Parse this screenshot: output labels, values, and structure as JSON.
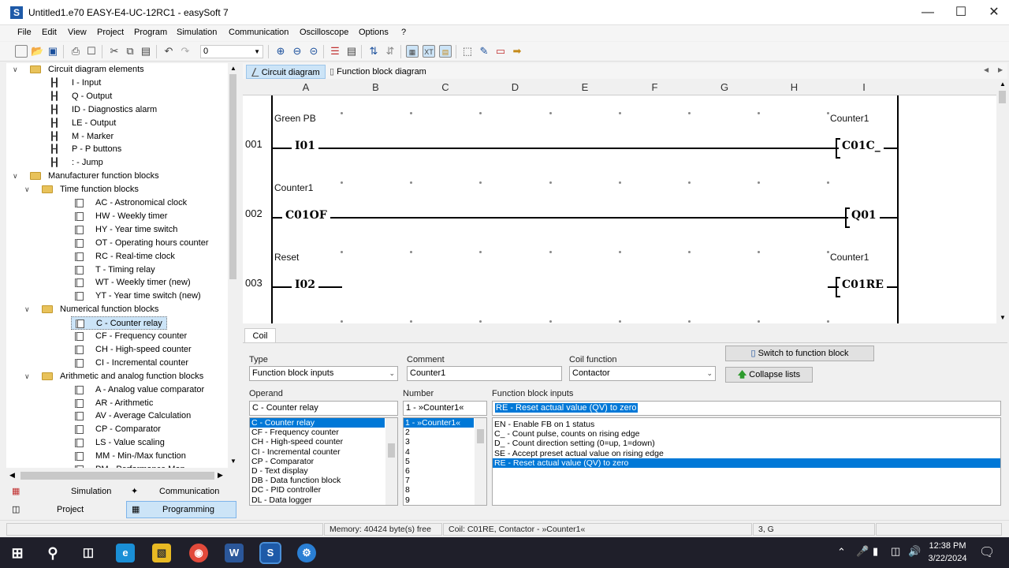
{
  "window": {
    "title": "Untitled1.e70 EASY-E4-UC-12RC1 - easySoft 7",
    "app_icon_letter": "S"
  },
  "menu": [
    "File",
    "Edit",
    "View",
    "Project",
    "Program",
    "Simulation",
    "Communication",
    "Oscilloscope",
    "Options",
    "?"
  ],
  "toolbar": {
    "zoom_value": "0"
  },
  "tree": [
    {
      "level": 0,
      "expanded": true,
      "icon": "folder",
      "label": "Circuit diagram elements"
    },
    {
      "level": 1,
      "icon": "contact",
      "label": "I - Input"
    },
    {
      "level": 1,
      "icon": "contact",
      "label": "Q - Output"
    },
    {
      "level": 1,
      "icon": "contact",
      "label": "ID - Diagnostics alarm"
    },
    {
      "level": 1,
      "icon": "contact",
      "label": "LE - Output"
    },
    {
      "level": 1,
      "icon": "contact",
      "label": "M - Marker"
    },
    {
      "level": 1,
      "icon": "contact",
      "label": "P - P buttons"
    },
    {
      "level": 1,
      "icon": "contact",
      "label": ": - Jump"
    },
    {
      "level": 0,
      "expanded": true,
      "icon": "folder",
      "label": "Manufacturer function blocks"
    },
    {
      "level": 1,
      "expanded": true,
      "icon": "folder",
      "label": "Time function blocks"
    },
    {
      "level": 2,
      "icon": "fb",
      "label": "AC - Astronomical clock"
    },
    {
      "level": 2,
      "icon": "fb",
      "label": "HW - Weekly timer"
    },
    {
      "level": 2,
      "icon": "fb",
      "label": "HY - Year time switch"
    },
    {
      "level": 2,
      "icon": "fb",
      "label": "OT - Operating hours counter"
    },
    {
      "level": 2,
      "icon": "fb",
      "label": "RC - Real-time clock"
    },
    {
      "level": 2,
      "icon": "fb",
      "label": "T - Timing relay"
    },
    {
      "level": 2,
      "icon": "fb",
      "label": "WT - Weekly timer (new)"
    },
    {
      "level": 2,
      "icon": "fb",
      "label": "YT - Year time switch (new)"
    },
    {
      "level": 1,
      "expanded": true,
      "icon": "folder",
      "label": "Numerical function blocks"
    },
    {
      "level": 2,
      "icon": "fb",
      "label": "C - Counter relay",
      "selected": true
    },
    {
      "level": 2,
      "icon": "fb",
      "label": "CF - Frequency counter"
    },
    {
      "level": 2,
      "icon": "fb",
      "label": "CH - High-speed counter"
    },
    {
      "level": 2,
      "icon": "fb",
      "label": "CI - Incremental counter"
    },
    {
      "level": 1,
      "expanded": true,
      "icon": "folder",
      "label": "Arithmetic and analog function blocks"
    },
    {
      "level": 2,
      "icon": "fb",
      "label": "A - Analog value comparator"
    },
    {
      "level": 2,
      "icon": "fb",
      "label": "AR - Arithmetic"
    },
    {
      "level": 2,
      "icon": "fb",
      "label": "AV - Average Calculation"
    },
    {
      "level": 2,
      "icon": "fb",
      "label": "CP - Comparator"
    },
    {
      "level": 2,
      "icon": "fb",
      "label": "LS - Value scaling"
    },
    {
      "level": 2,
      "icon": "fb",
      "label": "MM - Min-/Max function"
    },
    {
      "level": 2,
      "icon": "fb",
      "label": "PM - Performance Map"
    }
  ],
  "left_tabs": {
    "simulation": "Simulation",
    "communication": "Communication",
    "project": "Project",
    "programming": "Programming"
  },
  "diagram_tabs": {
    "circuit": "Circuit diagram",
    "fbd": "Function block diagram"
  },
  "columns": [
    "A",
    "B",
    "C",
    "D",
    "E",
    "F",
    "G",
    "H",
    "I"
  ],
  "rungs": [
    {
      "num": "001",
      "label_left": "Green PB",
      "contact": "I01",
      "label_right": "Counter1",
      "coil": "C01C_"
    },
    {
      "num": "002",
      "label_left": "Counter1",
      "contact": "C01OF",
      "label_right": "",
      "coil": "Q01"
    },
    {
      "num": "003",
      "label_left": "Reset",
      "contact": "I02",
      "label_right": "Counter1",
      "coil": "C01RE"
    }
  ],
  "panel": {
    "tab": "Coil",
    "type_label": "Type",
    "type_value": "Function block inputs",
    "comment_label": "Comment",
    "comment_value": "Counter1",
    "coilfn_label": "Coil function",
    "coilfn_value": "Contactor",
    "switch_btn": "Switch to function block",
    "collapse_btn": "Collapse lists",
    "operand_label": "Operand",
    "operand_value": "C - Counter relay",
    "operand_list": [
      "C - Counter relay",
      "CF - Frequency counter",
      "CH - High-speed counter",
      "CI - Incremental counter",
      "CP - Comparator",
      "D - Text display",
      "DB - Data function block",
      "DC - PID controller",
      "DL - Data logger"
    ],
    "number_label": "Number",
    "number_value": "1 - »Counter1«",
    "number_list": [
      "1 - »Counter1«",
      "2",
      "3",
      "4",
      "5",
      "6",
      "7",
      "8",
      "9"
    ],
    "fbi_label": "Function block inputs",
    "fbi_value": "RE - Reset actual value  (QV) to zero",
    "fbi_list": [
      "EN - Enable FB on 1 status",
      "C_ - Count pulse, counts on rising edge",
      "D_ - Count direction setting (0=up, 1=down)",
      "SE - Accept preset actual value on rising edge",
      "RE - Reset actual value  (QV) to zero"
    ]
  },
  "status": {
    "memory": "Memory: 40424 byte(s) free",
    "coil": "Coil: C01RE, Contactor - »Counter1«",
    "pos": "3, G"
  },
  "taskbar": {
    "time": "12:38 PM",
    "date": "3/22/2024"
  }
}
